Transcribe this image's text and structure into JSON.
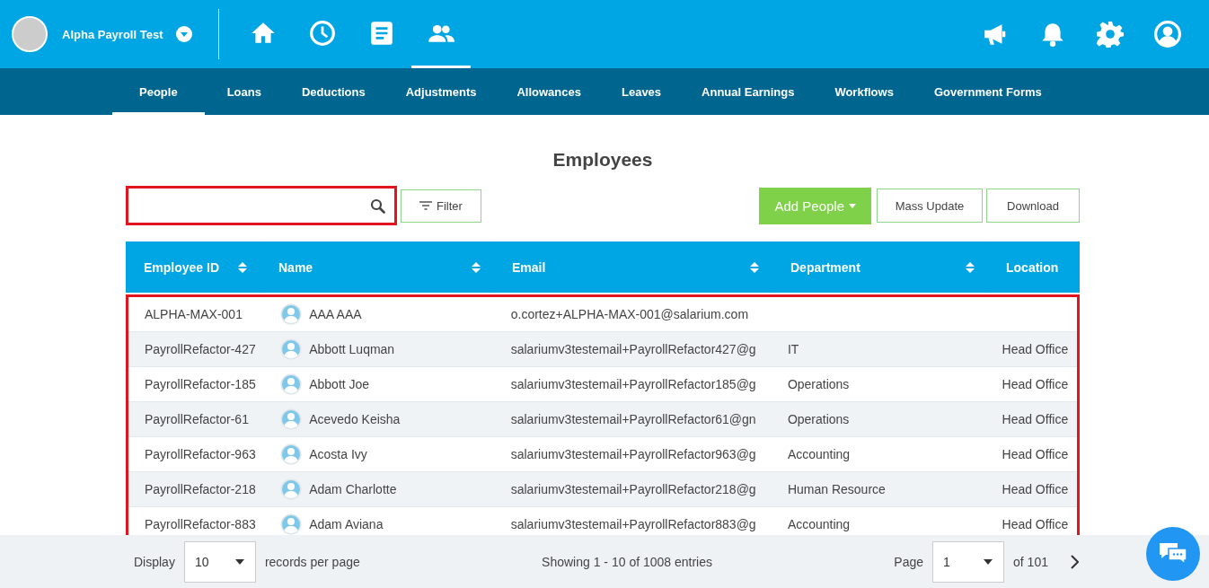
{
  "company": {
    "name": "Alpha Payroll Test"
  },
  "main_nav": [
    {
      "selected": false
    },
    {
      "selected": false
    },
    {
      "selected": false
    },
    {
      "selected": true
    }
  ],
  "sub_nav": [
    {
      "label": "People",
      "selected": true
    },
    {
      "label": "Loans",
      "selected": false
    },
    {
      "label": "Deductions",
      "selected": false
    },
    {
      "label": "Adjustments",
      "selected": false
    },
    {
      "label": "Allowances",
      "selected": false
    },
    {
      "label": "Leaves",
      "selected": false
    },
    {
      "label": "Annual Earnings",
      "selected": false
    },
    {
      "label": "Workflows",
      "selected": false
    },
    {
      "label": "Government Forms",
      "selected": false
    }
  ],
  "page_title": "Employees",
  "toolbar": {
    "filter": "Filter",
    "add": "Add People",
    "mass_update": "Mass Update",
    "download": "Download"
  },
  "table": {
    "columns": [
      {
        "label": "Employee ID",
        "sortable": true
      },
      {
        "label": "Name",
        "sortable": true
      },
      {
        "label": "Email",
        "sortable": true
      },
      {
        "label": "Department",
        "sortable": true
      },
      {
        "label": "Location",
        "sortable": false
      }
    ],
    "rows": [
      {
        "id": "ALPHA-MAX-001",
        "name": "AAA AAA",
        "email": "o.cortez+ALPHA-MAX-001@salarium.com",
        "department": "",
        "location": ""
      },
      {
        "id": "PayrollRefactor-427",
        "name": "Abbott Luqman",
        "email": "salariumv3testemail+PayrollRefactor427@g",
        "department": "IT",
        "location": "Head Office"
      },
      {
        "id": "PayrollRefactor-185",
        "name": "Abbott Joe",
        "email": "salariumv3testemail+PayrollRefactor185@g",
        "department": "Operations",
        "location": "Head Office"
      },
      {
        "id": "PayrollRefactor-61",
        "name": "Acevedo Keisha",
        "email": "salariumv3testemail+PayrollRefactor61@gn",
        "department": "Operations",
        "location": "Head Office"
      },
      {
        "id": "PayrollRefactor-963",
        "name": "Acosta Ivy",
        "email": "salariumv3testemail+PayrollRefactor963@g",
        "department": "Accounting",
        "location": "Head Office"
      },
      {
        "id": "PayrollRefactor-218",
        "name": "Adam Charlotte",
        "email": "salariumv3testemail+PayrollRefactor218@g",
        "department": "Human Resource",
        "location": "Head Office"
      },
      {
        "id": "PayrollRefactor-883",
        "name": "Adam Aviana",
        "email": "salariumv3testemail+PayrollRefactor883@g",
        "department": "Accounting",
        "location": "Head Office"
      }
    ]
  },
  "footer": {
    "display_label": "Display",
    "page_size": "10",
    "records_label": "records per page",
    "showing": "Showing 1 - 10 of 1008 entries",
    "page_label": "Page",
    "page": "1",
    "of_label": "of",
    "total_pages": "101"
  }
}
